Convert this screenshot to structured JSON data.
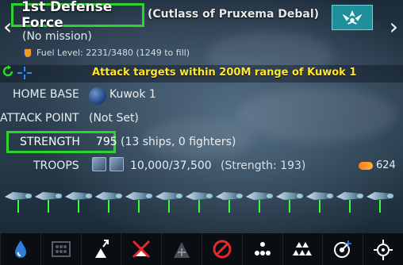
{
  "header": {
    "fleet_name": "1st Defense Force",
    "ship_class": "(Cutlass of Pruxema Debal)",
    "mission": "(No mission)",
    "fuel": "Fuel Level: 2231/3480 (1249 to fill)"
  },
  "attack_notice": "Attack targets within 200M range of Kuwok 1",
  "rows": {
    "home_base_label": "HOME BASE",
    "home_base_value": "Kuwok 1",
    "attack_point_label": "ATTACK POINT",
    "attack_point_value": "(Not Set)",
    "strength_label": "STRENGTH",
    "strength_value": "795",
    "strength_detail": "(13 ships, 0 fighters)",
    "troops_label": "TROOPS",
    "troops_value": "10,000/37,500",
    "troops_strength": "(Strength: 193)",
    "ammo_value": "624"
  },
  "ships": {
    "count": 13,
    "health_color": "#35ff35"
  },
  "toolbar": [
    {
      "name": "fuel-tool",
      "icon": "fuel-drop-icon"
    },
    {
      "name": "formation-tool",
      "icon": "grid-formation-icon"
    },
    {
      "name": "move-tool",
      "icon": "arrow-up-right-icon"
    },
    {
      "name": "no-attack-tool",
      "icon": "cross-out-icon"
    },
    {
      "name": "add-tool",
      "icon": "plus-triangle-icon"
    },
    {
      "name": "stop-tool",
      "icon": "no-entry-icon"
    },
    {
      "name": "spread-tool",
      "icon": "dots-icon"
    },
    {
      "name": "fleet-tool",
      "icon": "triangles-icon"
    },
    {
      "name": "scan-tool",
      "icon": "radar-icon"
    },
    {
      "name": "gear-tool",
      "icon": "gear-icon"
    }
  ],
  "colors": {
    "highlight": "#2cd52c",
    "notice": "#ffe72e",
    "emblem_bg": "#1f8f9c"
  }
}
